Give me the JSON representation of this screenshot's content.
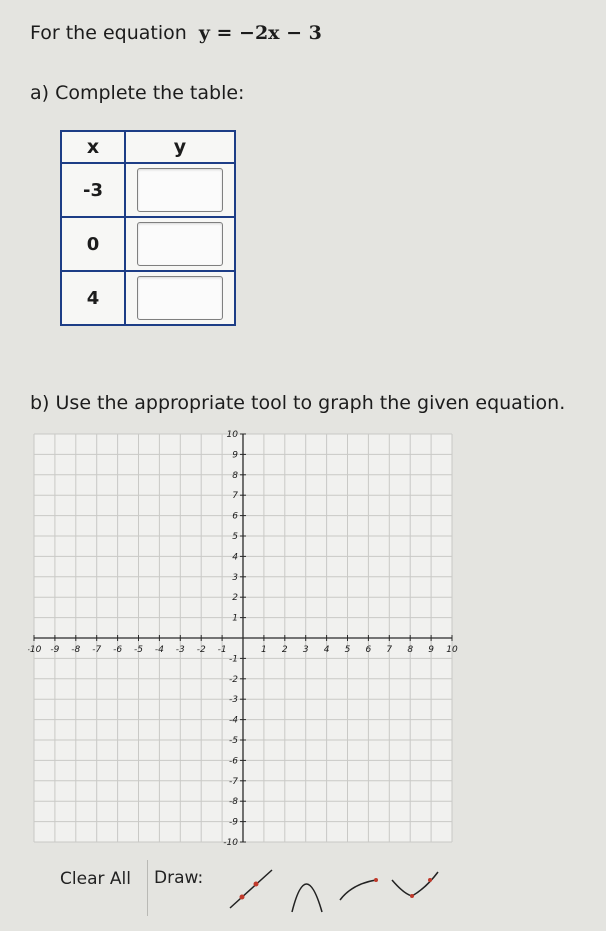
{
  "prompt": {
    "lead": "For the equation",
    "equation": "y = −2x − 3"
  },
  "part_a": {
    "label": "a) Complete the table:"
  },
  "table": {
    "headers": {
      "x": "x",
      "y": "y"
    },
    "rows": [
      {
        "x": "-3"
      },
      {
        "x": "0"
      },
      {
        "x": "4"
      }
    ]
  },
  "part_b": {
    "label": "b) Use the appropriate tool to graph the given equation."
  },
  "graph": {
    "x_range": [
      -10,
      10
    ],
    "y_range": [
      -10,
      10
    ],
    "grid": true,
    "x_ticks": [
      "-10",
      "-9",
      "-8",
      "-7",
      "-6",
      "-5",
      "-4",
      "-3",
      "-2",
      "-1",
      "1",
      "2",
      "3",
      "4",
      "5",
      "6",
      "7",
      "8",
      "9",
      "10"
    ],
    "y_ticks": [
      "10",
      "9",
      "8",
      "7",
      "6",
      "5",
      "4",
      "3",
      "2",
      "1",
      "-1",
      "-2",
      "-3",
      "-4",
      "-5",
      "-6",
      "-7",
      "-8",
      "-9",
      "-10"
    ]
  },
  "toolbar": {
    "clear_label": "Clear All",
    "draw_label": "Draw:",
    "tools": [
      "line-tool-icon",
      "parabola-down-tool-icon",
      "curve-tool-icon",
      "check-curve-tool-icon"
    ]
  }
}
